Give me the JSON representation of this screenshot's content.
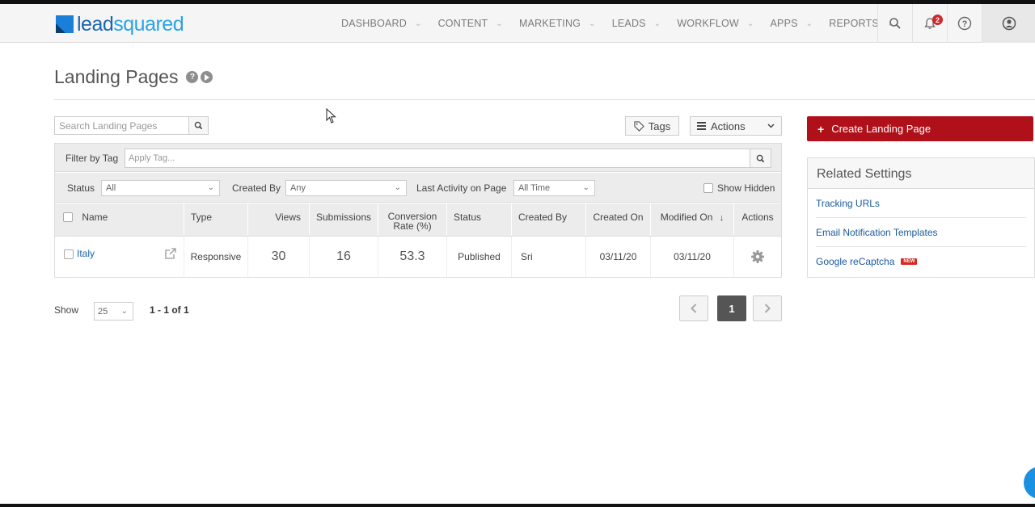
{
  "brand": {
    "part1": "lead",
    "part2": "squared"
  },
  "nav": {
    "items": [
      {
        "label": "DASHBOARD"
      },
      {
        "label": "CONTENT"
      },
      {
        "label": "MARKETING"
      },
      {
        "label": "LEADS"
      },
      {
        "label": "WORKFLOW"
      },
      {
        "label": "APPS"
      },
      {
        "label": "REPORTS"
      }
    ],
    "notification_count": "2"
  },
  "page": {
    "title": "Landing Pages"
  },
  "toolbar": {
    "search_placeholder": "Search Landing Pages",
    "tags_label": "Tags",
    "actions_label": "Actions"
  },
  "filters": {
    "filter_by_tag_label": "Filter by Tag",
    "tag_placeholder": "Apply Tag...",
    "status_label": "Status",
    "status_value": "All",
    "created_by_label": "Created By",
    "created_by_value": "Any",
    "last_activity_label": "Last Activity on Page",
    "last_activity_value": "All Time",
    "show_hidden_label": "Show Hidden"
  },
  "table": {
    "columns": {
      "name": "Name",
      "type": "Type",
      "views": "Views",
      "submissions": "Submissions",
      "conversion_line1": "Conversion",
      "conversion_line2": "Rate (%)",
      "status": "Status",
      "created_by": "Created By",
      "created_on": "Created On",
      "modified_on": "Modified On",
      "actions": "Actions"
    },
    "rows": [
      {
        "name": "Italy",
        "type": "Responsive",
        "views": "30",
        "submissions": "16",
        "conversion_rate": "53.3",
        "status": "Published",
        "created_by": "Sri",
        "created_on": "03/11/20",
        "modified_on": "03/11/20"
      }
    ]
  },
  "pagination": {
    "show_label": "Show",
    "page_size": "25",
    "range_text": "1 - 1 of 1",
    "current_page": "1"
  },
  "sidebar": {
    "create_label": "Create Landing Page",
    "related_title": "Related Settings",
    "links": [
      {
        "label": "Tracking URLs"
      },
      {
        "label": "Email Notification Templates"
      },
      {
        "label": "Google reCaptcha",
        "badge": "NEW"
      }
    ]
  },
  "colors": {
    "brand_blue": "#1b7ed8",
    "create_button": "#b0101a",
    "link": "#1a5a9e",
    "badge_red": "#d0282d"
  }
}
